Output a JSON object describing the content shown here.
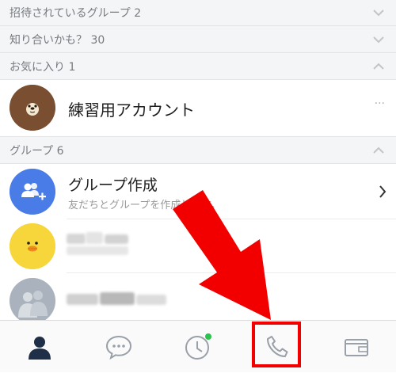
{
  "sections": {
    "invited": {
      "label": "招待されているグループ 2"
    },
    "suggested": {
      "label": "知り合いかも？ 30"
    },
    "favorites": {
      "label": "お気に入り 1"
    },
    "groups": {
      "label": "グループ 6"
    }
  },
  "favorite_friend": {
    "name": "練習用アカウント",
    "more": "···"
  },
  "create_group": {
    "title": "グループ作成",
    "subtitle": "友だちとグループを作成します。"
  },
  "tabs": [
    {
      "icon": "person-icon",
      "active": true
    },
    {
      "icon": "chat-icon"
    },
    {
      "icon": "clock-icon",
      "badge": true
    },
    {
      "icon": "phone-icon",
      "highlighted": true
    },
    {
      "icon": "wallet-icon"
    }
  ],
  "colors": {
    "section_bg": "#f4f5f7",
    "group_create_blue": "#4a7ce8",
    "badge_green": "#2bc34a",
    "annotation_red": "#f20000",
    "tab_active": "#1f2f47"
  }
}
